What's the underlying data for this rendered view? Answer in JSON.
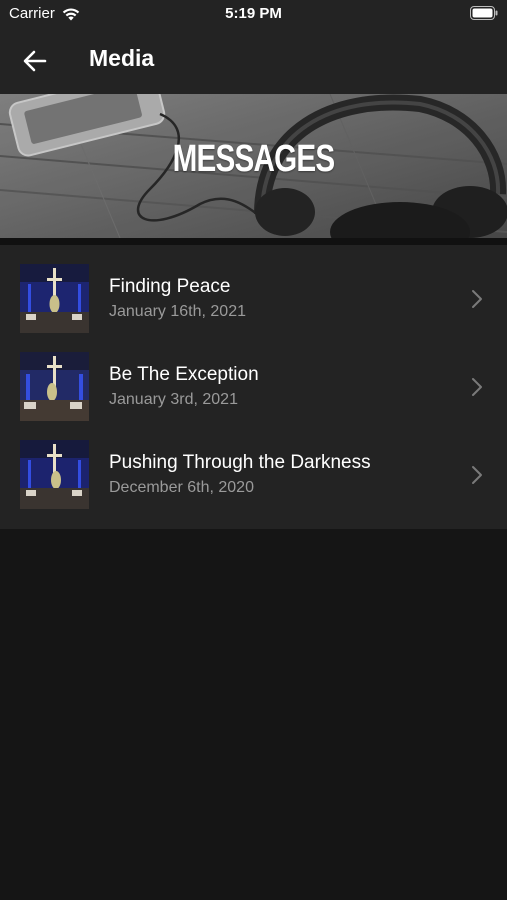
{
  "status": {
    "carrier": "Carrier",
    "time": "5:19 PM"
  },
  "nav": {
    "title": "Media"
  },
  "banner": {
    "title": "MESSAGES"
  },
  "messages": [
    {
      "title": "Finding Peace",
      "date": "January 16th, 2021"
    },
    {
      "title": "Be The Exception",
      "date": "January 3rd, 2021"
    },
    {
      "title": "Pushing Through the Darkness",
      "date": "December 6th, 2020"
    }
  ],
  "colors": {
    "background": "#151515",
    "bar": "#232323",
    "secondary_text": "#9a9a9a"
  }
}
